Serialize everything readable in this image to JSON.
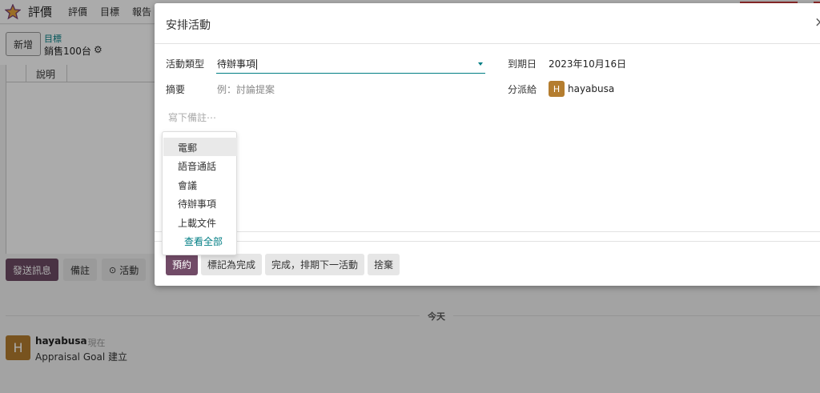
{
  "app": {
    "name": "評價",
    "menus": [
      "評價",
      "目標",
      "報告"
    ]
  },
  "control": {
    "new_button": "新增",
    "breadcrumb_link": "目標",
    "record_title": "銷售100台"
  },
  "sheet": {
    "column_header": "說明"
  },
  "chatter": {
    "send_message": "發送訊息",
    "log_note": "備註",
    "activity": "活動",
    "day_separator": "今天",
    "message": {
      "author": "hayabusa",
      "avatar_letter": "H",
      "time": "- 現在",
      "body": "Appraisal Goal 建立"
    }
  },
  "modal": {
    "title": "安排活動",
    "close_icon": "×",
    "activity_type_label": "活動類型",
    "activity_type_value": "待辦事項",
    "summary_label": "摘要",
    "summary_placeholder": "例：討論提案",
    "due_date_label": "到期日",
    "due_date_value": "2023年10月16日",
    "assigned_to_label": "分派給",
    "assignee_letter": "H",
    "assignee_name": "hayabusa",
    "note_placeholder": "寫下備註⋯",
    "buttons": {
      "schedule": "預約",
      "mark_done": "標記為完成",
      "done_schedule_next": "完成，排期下一活動",
      "discard": "捨棄"
    }
  },
  "dropdown": {
    "options": [
      "電郵",
      "語音通話",
      "會議",
      "待辦事項",
      "上載文件"
    ],
    "highlighted": "電郵",
    "view_all": "查看全部"
  },
  "colors": {
    "brand": "#714b67",
    "accent": "#017e84",
    "avatar": "#b47d2f",
    "alert": "#d23f3f"
  }
}
